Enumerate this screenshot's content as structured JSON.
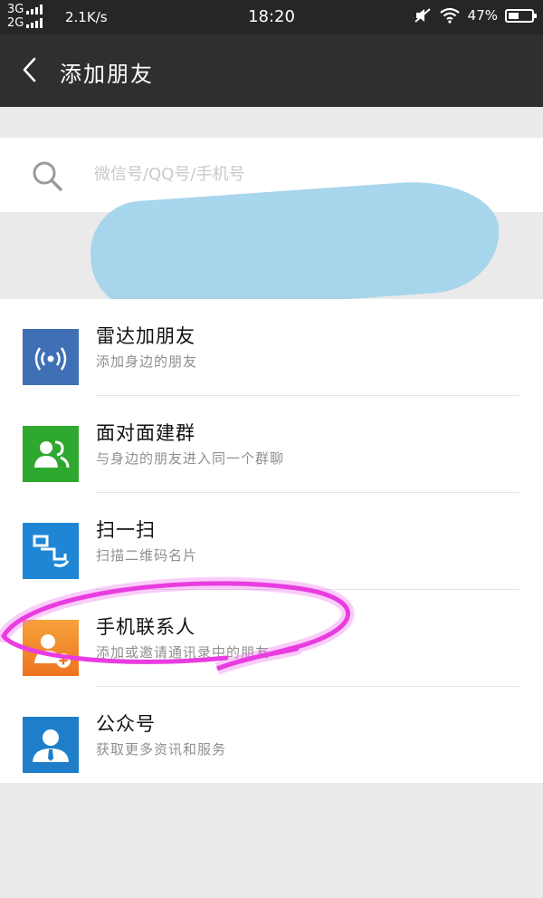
{
  "status_bar": {
    "net_top": "3G",
    "net_bottom": "2G",
    "speed": "2.1K/s",
    "time": "18:20",
    "battery": "47%",
    "battery_level": 0.47
  },
  "nav": {
    "back_icon": "chevron-left",
    "title": "添加朋友"
  },
  "search": {
    "placeholder": "微信号/QQ号/手机号",
    "value": ""
  },
  "items": [
    {
      "title": "雷达加朋友",
      "subtitle": "添加身边的朋友",
      "icon": "radar-icon",
      "color": "#3f6fb5"
    },
    {
      "title": "面对面建群",
      "subtitle": "与身边的朋友进入同一个群聊",
      "icon": "group-icon",
      "color": "#2ea82e"
    },
    {
      "title": "扫一扫",
      "subtitle": "扫描二维码名片",
      "icon": "scan-icon",
      "color": "#1e86d4"
    },
    {
      "title": "手机联系人",
      "subtitle": "添加或邀请通讯录中的朋友",
      "icon": "contact-add-icon",
      "color": "#f08a22"
    },
    {
      "title": "公众号",
      "subtitle": "获取更多资讯和服务",
      "icon": "official-account-icon",
      "color": "#1e7ec9"
    }
  ],
  "colors": {
    "statusbar": "#262626",
    "navbar": "#2f2f2f",
    "background": "#eaeaea",
    "highlight": "#e93ce0",
    "redaction": "#9fd3ec"
  }
}
